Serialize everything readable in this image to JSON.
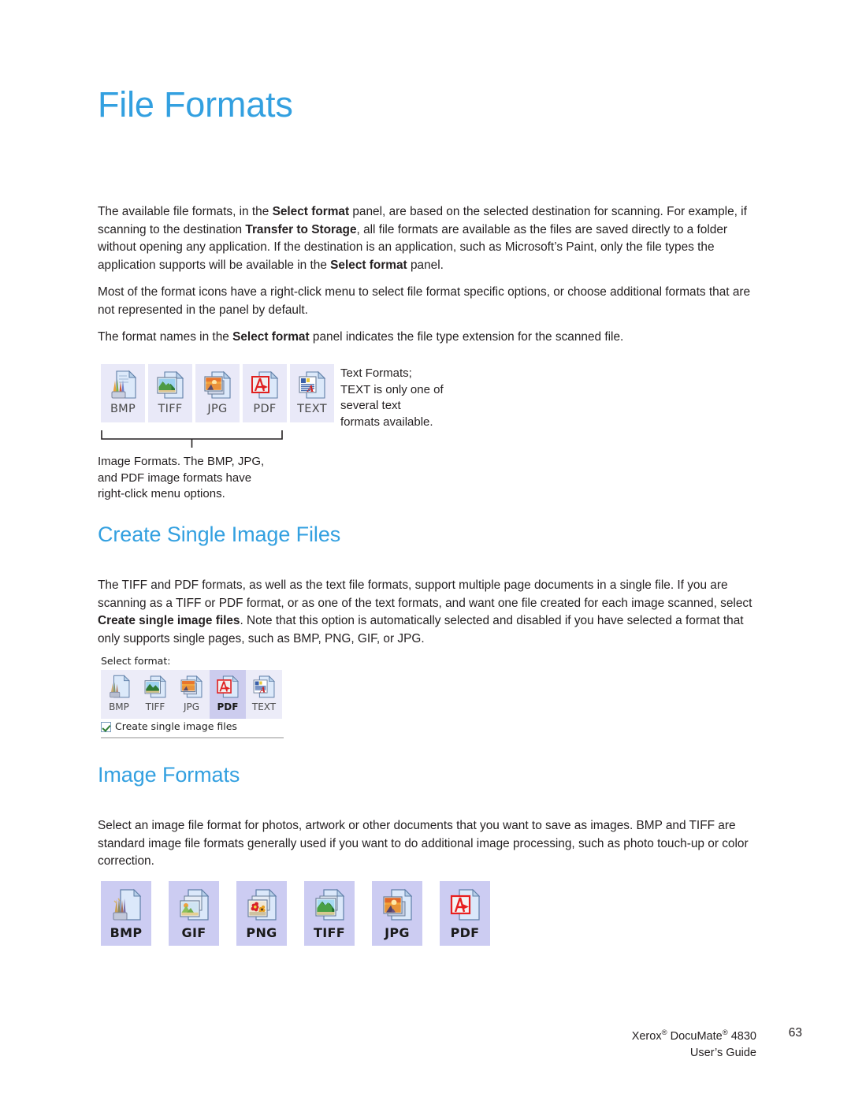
{
  "document": {
    "title": "File Formats"
  },
  "headings": {
    "main": "File Formats",
    "create_single": "Create Single Image Files",
    "image_formats": "Image Formats"
  },
  "paragraphs": {
    "p1_part1": "The available file formats, in the ",
    "p1_bold1": "Select format",
    "p1_part2": " panel, are based on the selected destination for scanning. For example, if scanning to the destination ",
    "p1_bold2": "Transfer to Storage",
    "p1_part3": ", all file formats are available as the files are saved directly to a folder without opening any application. If the destination is an application, such as Microsoft’s Paint, only the file types the application supports will be available in the ",
    "p1_bold3": "Select format",
    "p1_part4": " panel.",
    "p2": "Most of the format icons have a right-click menu to select file format specific options, or choose additional formats that are not represented in the panel by default.",
    "p3_part1": "The format names in the ",
    "p3_bold1": "Select format",
    "p3_part2": " panel indicates the file type extension for the scanned file.",
    "p4_part1": "The TIFF and PDF formats, as well as the text file formats, support multiple page documents in a single file. If you are scanning as a TIFF or PDF format, or as one of the text formats, and want one file created for each image scanned, select ",
    "p4_bold1": "Create single image files",
    "p4_part2": ". Note that this option is automatically selected and disabled if you have selected a format that only supports single pages, such as BMP, PNG, GIF, or JPG.",
    "p5": "Select an image file format for photos, artwork or other documents that you want to save as images. BMP and TIFF are standard image file formats generally used if you want to do additional image processing, such as photo touch-up or color correction."
  },
  "format_row_1": {
    "tiles": [
      {
        "label": "BMP",
        "icon": "bmp-paintbrush-document-icon"
      },
      {
        "label": "TIFF",
        "icon": "tiff-landscape-photo-icon"
      },
      {
        "label": "JPG",
        "icon": "jpg-sunset-photo-icon"
      },
      {
        "label": "PDF",
        "icon": "pdf-acrobat-icon"
      },
      {
        "label": "TEXT",
        "icon": "text-document-icon"
      }
    ]
  },
  "callouts": {
    "text_formats": "Text Formats;\nTEXT is only one of\nseveral text\nformats available.",
    "text_formats_lines": [
      "Text Formats;",
      "TEXT is only one of",
      "several text",
      "formats available."
    ],
    "image_formats": "Image Formats. The BMP, JPG, and PDF image formats have right-click menu options.",
    "image_formats_lines": [
      "Image Formats. The BMP, JPG,",
      "and PDF image formats have",
      "right-click menu options."
    ]
  },
  "select_format_panel": {
    "label": "Select format:",
    "tiles": [
      {
        "label": "BMP",
        "icon": "bmp-paintbrush-document-icon",
        "selected": false
      },
      {
        "label": "TIFF",
        "icon": "tiff-landscape-photo-icon",
        "selected": false
      },
      {
        "label": "JPG",
        "icon": "jpg-sunset-photo-icon",
        "selected": false
      },
      {
        "label": "PDF",
        "icon": "pdf-acrobat-icon",
        "selected": true
      },
      {
        "label": "TEXT",
        "icon": "text-document-icon",
        "selected": false
      }
    ],
    "checkbox_label": "Create single image files",
    "checkbox_checked": true
  },
  "format_row_2": {
    "tiles": [
      {
        "label": "BMP",
        "icon": "bmp-paintbrush-document-icon"
      },
      {
        "label": "GIF",
        "icon": "gif-landscape-stack-icon"
      },
      {
        "label": "PNG",
        "icon": "png-flowers-photo-icon"
      },
      {
        "label": "TIFF",
        "icon": "tiff-landscape-photo-icon"
      },
      {
        "label": "JPG",
        "icon": "jpg-sunset-photo-icon"
      },
      {
        "label": "PDF",
        "icon": "pdf-acrobat-icon"
      }
    ]
  },
  "footer": {
    "product_pre": "Xerox",
    "product_mid": " DocuMate",
    "product_post": " 4830",
    "reg_mark": "®",
    "guide": "User’s Guide",
    "page_number": "63"
  },
  "colors": {
    "heading_blue": "#33a0e0",
    "body_text": "#231f20",
    "tile_bg_light": "#e9e9f8",
    "tile_bg_lavender": "#ccccf2",
    "tile_selected": "#ccccee"
  }
}
